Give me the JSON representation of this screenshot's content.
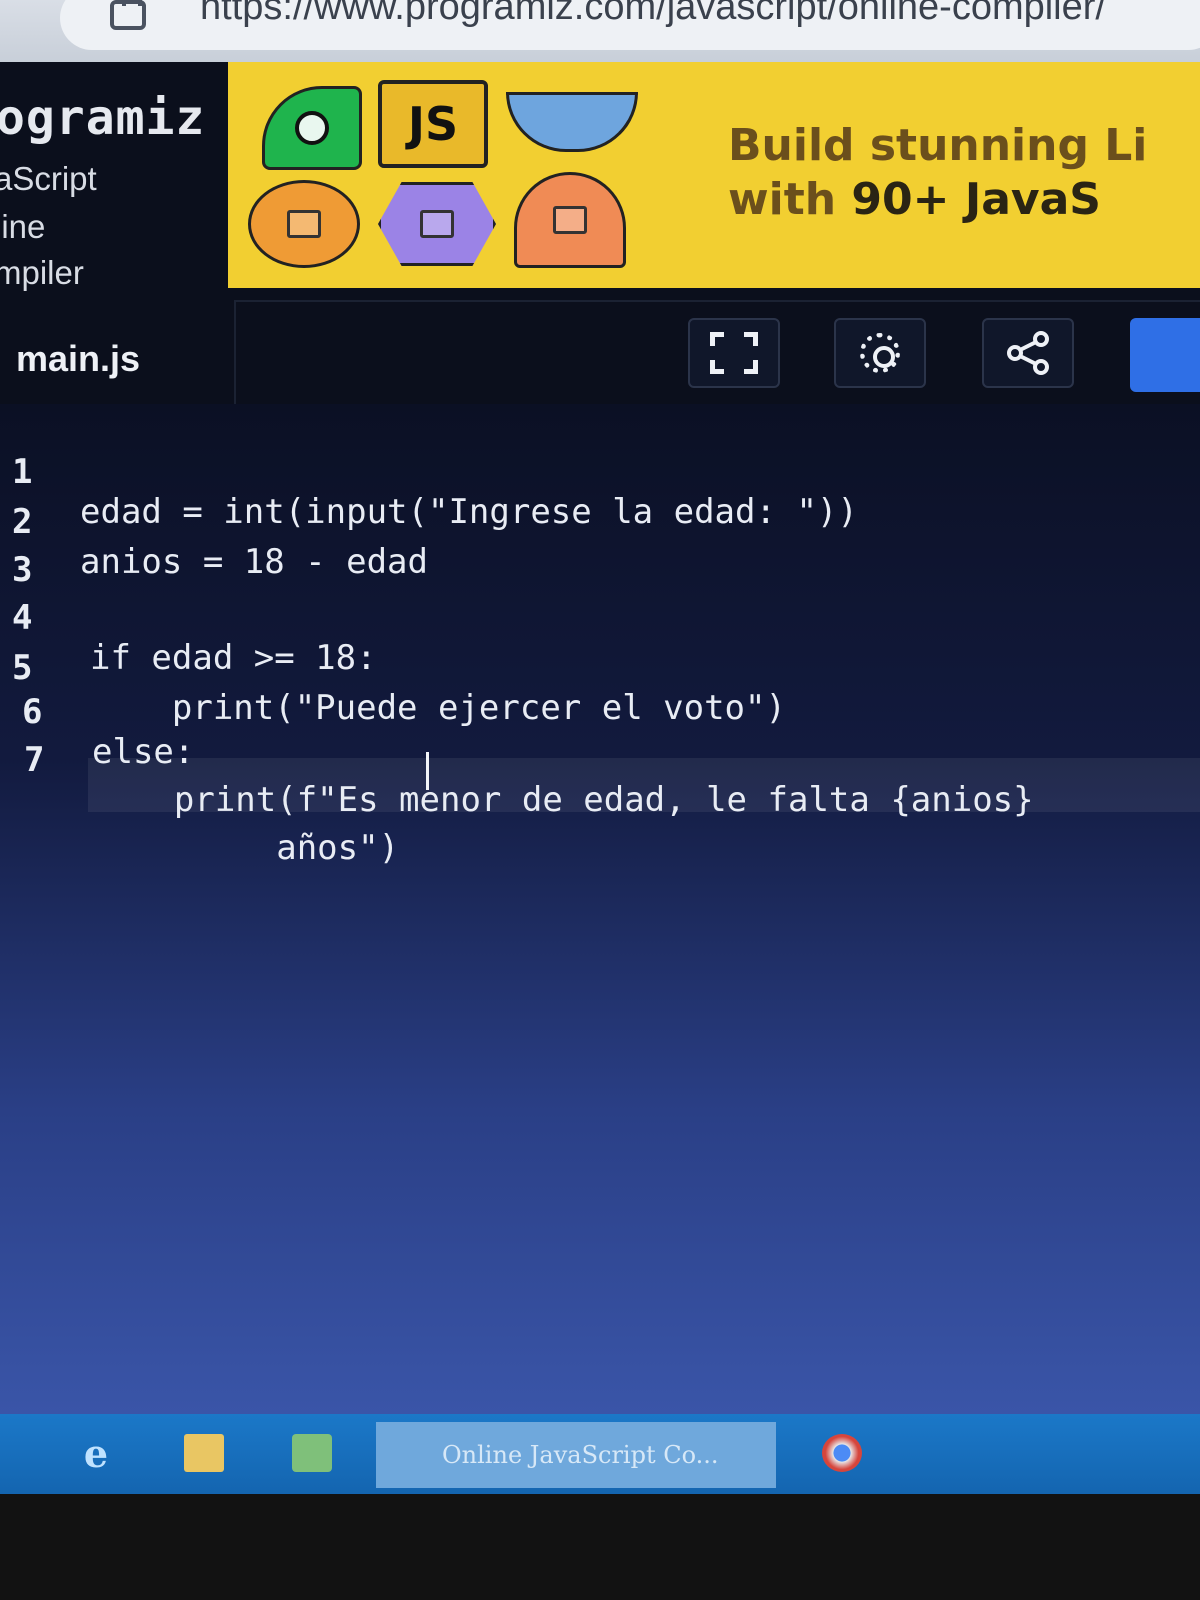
{
  "browser": {
    "url": "https://www.programiz.com/javascript/online-compiler/"
  },
  "brand": {
    "name": "ogramiz",
    "sub_lines": [
      "aScript",
      "line",
      "mpiler"
    ]
  },
  "ad": {
    "tile_js_label": "JS",
    "line1": "Build stunning Li",
    "line2_prefix": "with ",
    "line2_bold": "90+ JavaS"
  },
  "editor": {
    "file_tab": "main.js",
    "toolbar": [
      "fullscreen-icon",
      "settings-icon",
      "share-icon"
    ],
    "lines": [
      {
        "num": "1",
        "code": "edad = int(input(\"Ingrese la edad: \"))"
      },
      {
        "num": "2",
        "code": "anios = 18 - edad"
      },
      {
        "num": "3",
        "code": ""
      },
      {
        "num": "4",
        "code": "if edad >= 18:"
      },
      {
        "num": "5",
        "code": "    print(\"Puede ejercer el voto\")"
      },
      {
        "num": "6",
        "code": "else:"
      },
      {
        "num": "7",
        "code": "    print(f\"Es menor de edad, le falta {anios}"
      },
      {
        "num": "",
        "code": "         años\")"
      }
    ]
  },
  "taskbar": {
    "active_app": "Online JavaScript Co..."
  },
  "colors": {
    "ad_bg": "#f2cf31",
    "run_button": "#2f6fe6",
    "taskbar": "#1b78c8"
  }
}
